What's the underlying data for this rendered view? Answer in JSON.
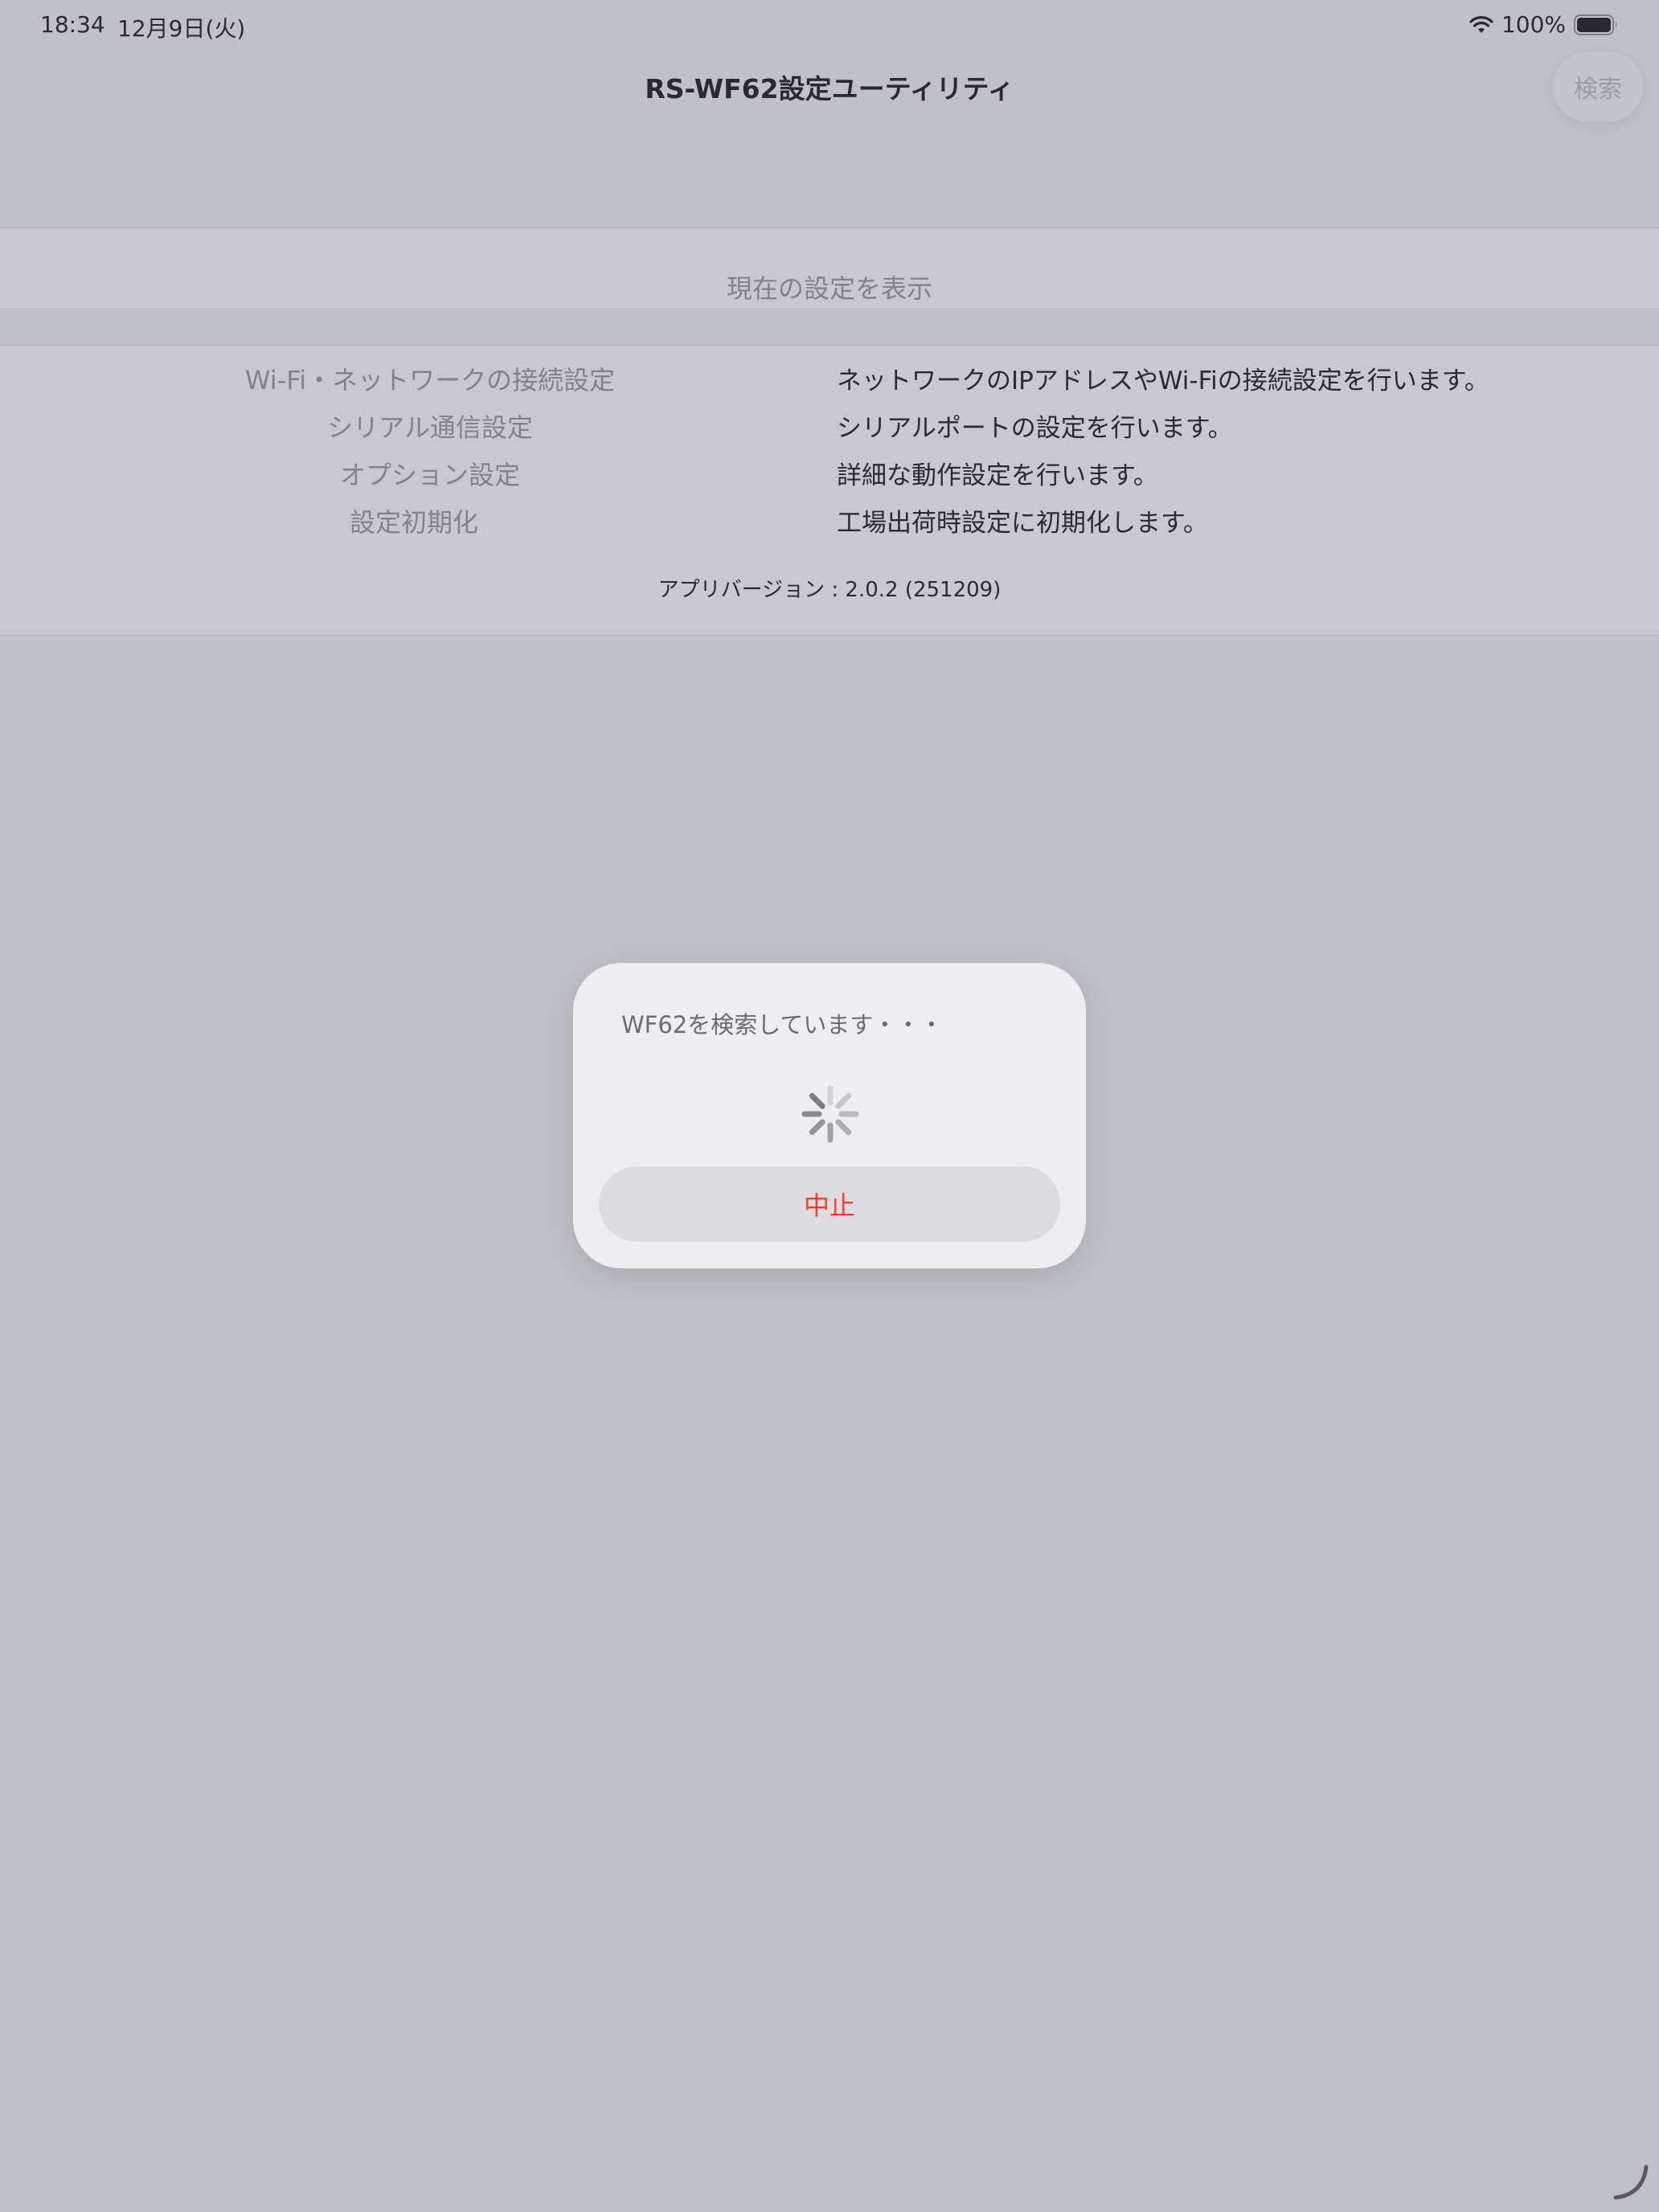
{
  "status_bar": {
    "time": "18:34",
    "date": "12月9日(火)",
    "battery_percent": "100%",
    "battery_level": 1.0
  },
  "nav": {
    "title": "RS-WF62設定ユーティリティ",
    "search_label": "検索"
  },
  "current_settings": {
    "label": "現在の設定を表示"
  },
  "menu": {
    "items": [
      {
        "label": "Wi-Fi・ネットワークの接続設定",
        "description": "ネットワークのIPアドレスやWi-Fiの接続設定を行います。"
      },
      {
        "label": "シリアル通信設定",
        "description": "シリアルポートの設定を行います。"
      },
      {
        "label": "オプション設定",
        "description": "詳細な動作設定を行います。"
      },
      {
        "label": "設定初期化",
        "description": "工場出荷時設定に初期化します。"
      }
    ],
    "version": "アプリバージョン : 2.0.2 (251209)"
  },
  "alert": {
    "message": "WF62を検索しています・・・",
    "stop_label": "中止",
    "stop_color": "#ff3b30"
  },
  "icons": {
    "wifi": "wifi-icon",
    "battery": "battery-icon",
    "spinner": "activity-spinner-icon",
    "handle": "resize-handle-icon"
  }
}
